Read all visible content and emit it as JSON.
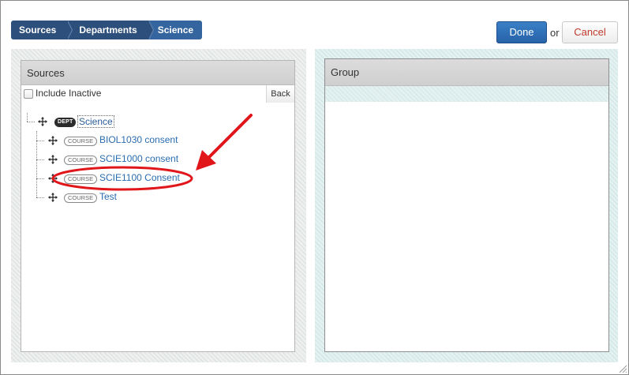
{
  "breadcrumb": [
    "Sources",
    "Departments",
    "Science"
  ],
  "actions": {
    "done_label": "Done",
    "or_label": "or",
    "cancel_label": "Cancel"
  },
  "sources_panel": {
    "title": "Sources",
    "include_inactive_label": "Include Inactive",
    "include_inactive_checked": false,
    "back_label": "Back",
    "tree": {
      "root": {
        "badge": "DEPT",
        "label": "Science"
      },
      "children": [
        {
          "badge": "COURSE",
          "label": "BIOL1030 consent"
        },
        {
          "badge": "COURSE",
          "label": "SCIE1000 consent"
        },
        {
          "badge": "COURSE",
          "label": "SCIE1100 Consent",
          "highlighted": true
        },
        {
          "badge": "COURSE",
          "label": "Test"
        }
      ]
    }
  },
  "group_panel": {
    "title": "Group"
  },
  "icons": {
    "tree_item": "move-icon",
    "annotation": "red-arrow-icon"
  },
  "colors": {
    "breadcrumb": "#2d4f7c",
    "done_button": "#2f6fb5",
    "cancel_text": "#c0392b",
    "link": "#2a6cb0",
    "annotation": "#e0161b"
  }
}
